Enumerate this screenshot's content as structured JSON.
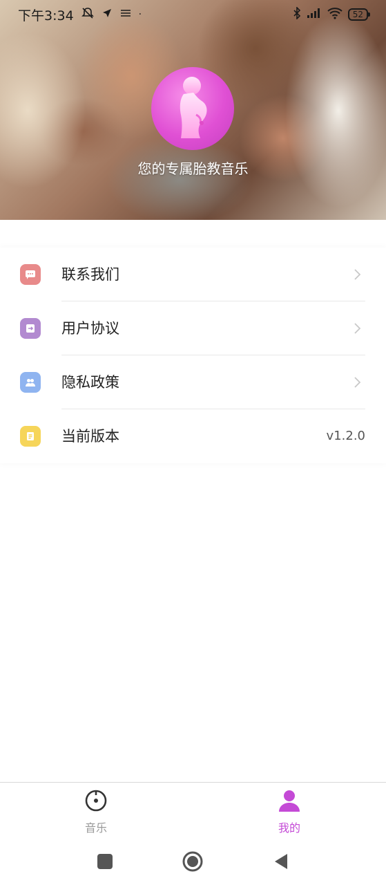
{
  "status_bar": {
    "time": "下午3:34",
    "battery": "52",
    "icons": [
      "muted-notification-icon",
      "navigation-icon",
      "vibrate-icon",
      "bluetooth-icon",
      "signal-icon",
      "wifi-icon",
      "battery-icon"
    ]
  },
  "hero": {
    "slogan": "您的专属胎教音乐",
    "logo_icon": "pregnant-woman-icon"
  },
  "menu": {
    "items": [
      {
        "label": "联系我们",
        "icon": "chat-bubble-icon",
        "icon_color": "#e88a8a"
      },
      {
        "label": "用户协议",
        "icon": "agreement-icon",
        "icon_color": "#b28ad0"
      },
      {
        "label": "隐私政策",
        "icon": "users-icon",
        "icon_color": "#8fb4f0"
      },
      {
        "label": "当前版本",
        "icon": "document-icon",
        "icon_color": "#f6d55a",
        "value": "v1.2.0"
      }
    ]
  },
  "bottom_nav": {
    "tabs": [
      {
        "label": "音乐",
        "icon": "music-disc-icon",
        "active": false
      },
      {
        "label": "我的",
        "icon": "user-icon",
        "active": true
      }
    ],
    "active_color": "#c44ad6",
    "inactive_color": "#999999"
  },
  "system_nav": {
    "buttons": [
      "recents-button",
      "home-button",
      "back-button"
    ]
  }
}
